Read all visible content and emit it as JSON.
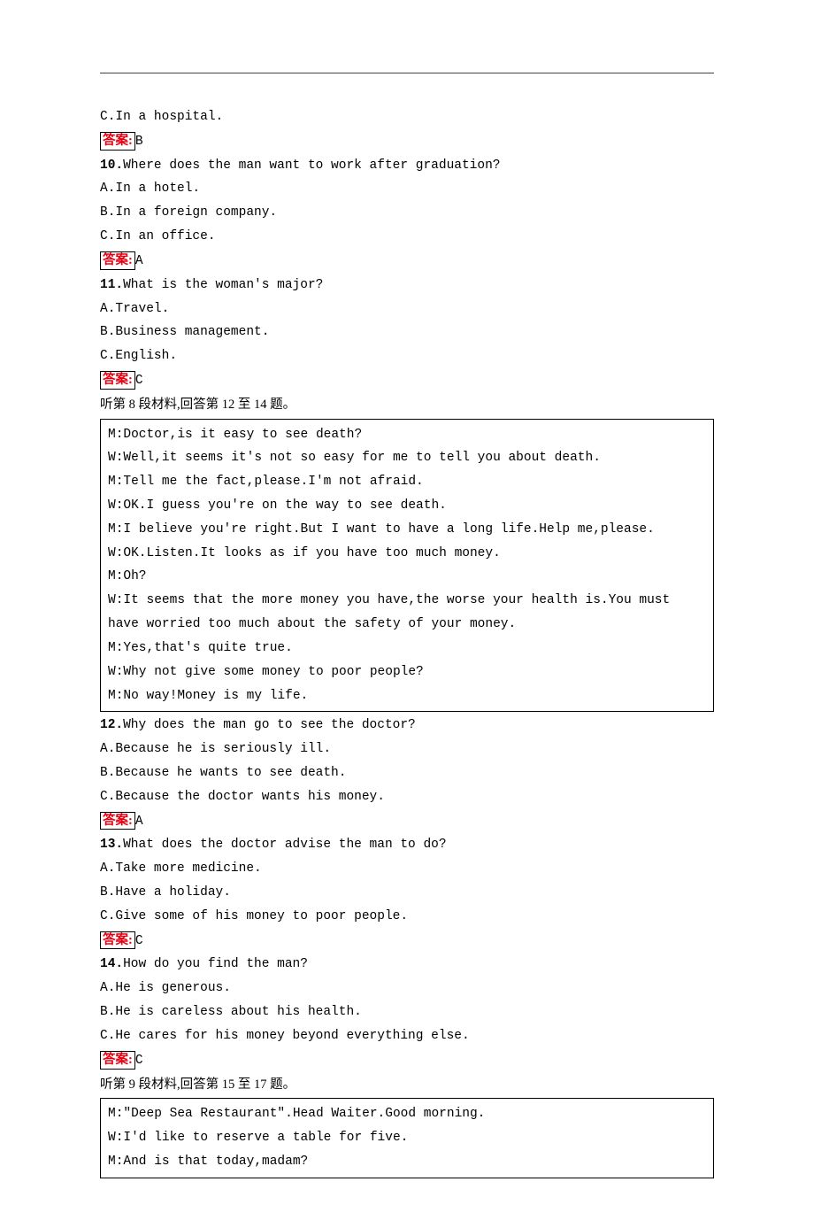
{
  "q9": {
    "optC": "C.In a hospital.",
    "ansLabel": "答案:",
    "ansVal": "B"
  },
  "q10": {
    "stem": "Where does the man want to work after graduation?",
    "num": "10.",
    "optA": "A.In a hotel.",
    "optB": "B.In a foreign company.",
    "optC": "C.In an office.",
    "ansLabel": "答案:",
    "ansVal": "A"
  },
  "q11": {
    "stem": "What is the woman's major?",
    "num": "11.",
    "optA": "A.Travel.",
    "optB": "B.Business management.",
    "optC": "C.English.",
    "ansLabel": "答案:",
    "ansVal": "C"
  },
  "intro8": "听第 8 段材料,回答第 12 至 14 题。",
  "script8": {
    "l1": "M:Doctor,is it easy to see death?",
    "l2": "W:Well,it seems it's not so easy for me to tell you about death.",
    "l3": "M:Tell me the fact,please.I'm not afraid.",
    "l4": "W:OK.I guess you're on the way to see death.",
    "l5": "M:I believe you're right.But I want to have a long life.Help me,please.",
    "l6": "W:OK.Listen.It looks as if you have too much money.",
    "l7": "M:Oh?",
    "l8": "W:It seems that the more money you have,the worse your health is.You must have worried too much about the safety of your money.",
    "l9": "M:Yes,that's quite true.",
    "l10": "W:Why not give some money to poor people?",
    "l11": "M:No way!Money is my life."
  },
  "q12": {
    "stem": "Why does the man go to see the doctor?",
    "num": "12.",
    "optA": "A.Because he is seriously ill.",
    "optB": "B.Because he wants to see death.",
    "optC": "C.Because the doctor wants his money.",
    "ansLabel": "答案:",
    "ansVal": "A"
  },
  "q13": {
    "stem": "What does the doctor advise the man to do?",
    "num": "13.",
    "optA": "A.Take more medicine.",
    "optB": "B.Have a holiday.",
    "optC": "C.Give some of his money to poor people.",
    "ansLabel": "答案:",
    "ansVal": "C"
  },
  "q14": {
    "stem": "How do you find the man?",
    "num": "14.",
    "optA": "A.He is generous.",
    "optB": "B.He is careless about his health.",
    "optC": "C.He cares for his money beyond everything else.",
    "ansLabel": "答案:",
    "ansVal": "C"
  },
  "intro9": "听第 9 段材料,回答第 15 至 17 题。",
  "script9": {
    "l1": "M:\"Deep Sea Restaurant\".Head Waiter.Good morning.",
    "l2": "W:I'd like to reserve a table for five.",
    "l3": "M:And is that today,madam?"
  }
}
